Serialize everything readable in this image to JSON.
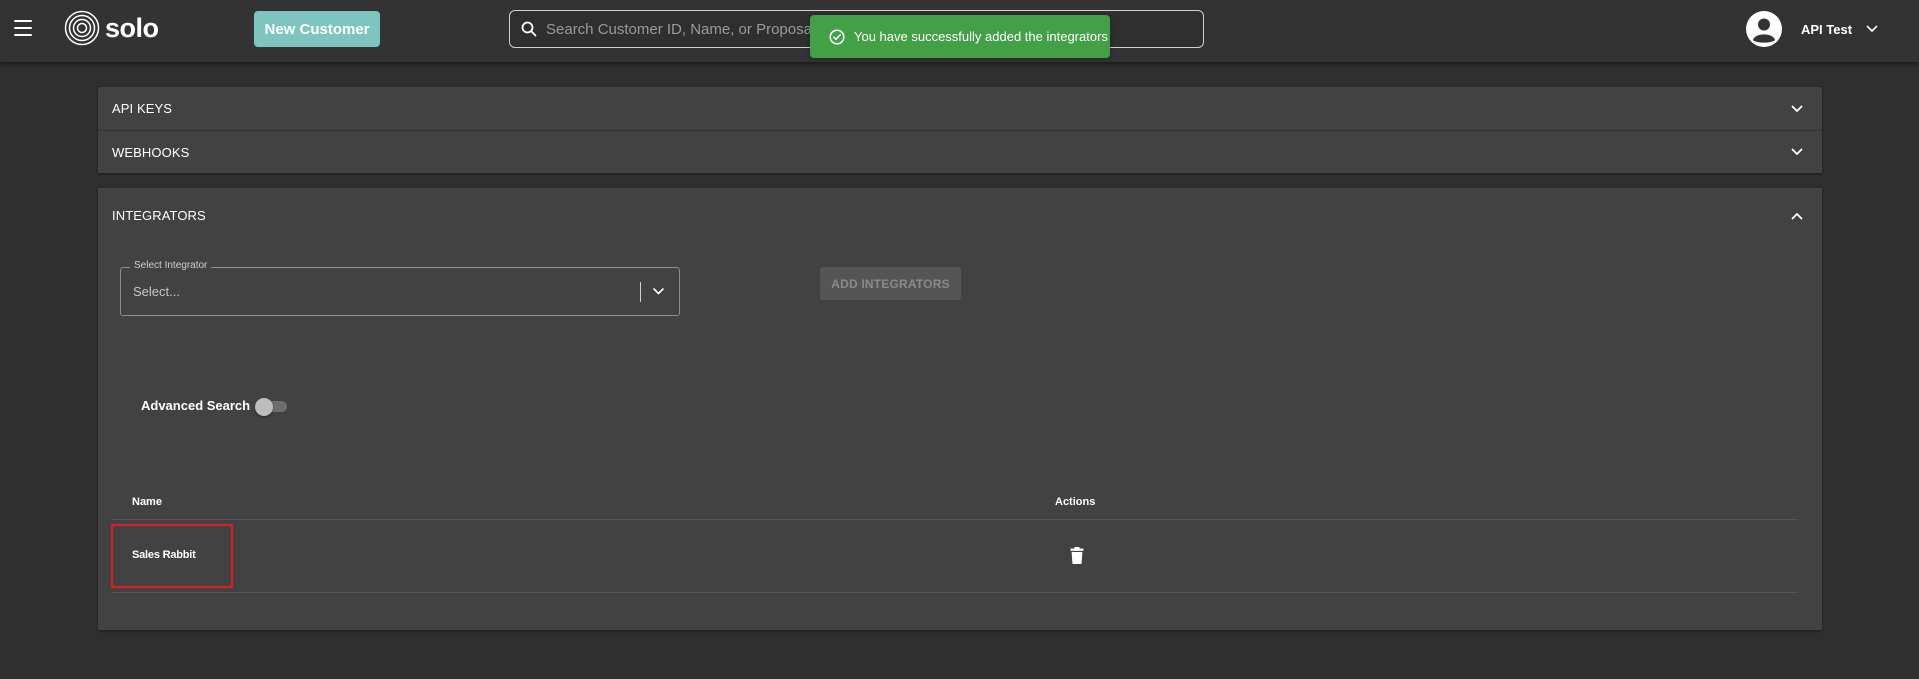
{
  "header": {
    "brand": "solo",
    "new_customer_label": "New Customer",
    "search_placeholder": "Search Customer ID, Name, or Proposal ID",
    "user_name": "API Test"
  },
  "toast": {
    "message": "You have successfully added the integrators",
    "color": "#43a047"
  },
  "sections": {
    "api_keys": "API KEYS",
    "webhooks": "WEBHOOKS",
    "integrators": "INTEGRATORS"
  },
  "integrators": {
    "select_label": "Select Integrator",
    "select_value": "Select...",
    "add_button": "ADD INTEGRATORS",
    "advanced_search_label": "Advanced Search",
    "advanced_search_enabled": false,
    "table": {
      "columns": [
        "Name",
        "Actions"
      ],
      "rows": [
        {
          "name": "Sales Rabbit"
        }
      ]
    }
  },
  "colors": {
    "accent": "#7ec4bf",
    "highlight": "#e01b24",
    "background": "#2f2f2f",
    "panel": "#424242"
  },
  "icons": [
    "menu-icon",
    "solo-logo-icon",
    "search-icon",
    "check-circle-icon",
    "user-avatar-icon",
    "chevron-down-icon",
    "chevron-up-icon",
    "trash-icon"
  ]
}
